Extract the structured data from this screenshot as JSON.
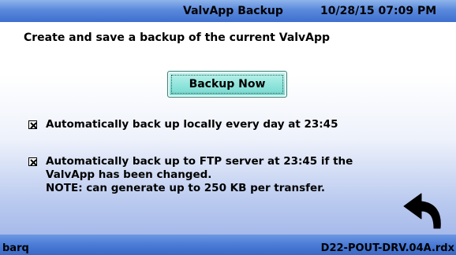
{
  "titlebar": {
    "title": "ValvApp Backup",
    "datetime": "10/28/15 07:09 PM"
  },
  "main": {
    "heading": "Create and save a backup of the current ValvApp",
    "backup_button_label": "Backup Now",
    "options": [
      {
        "checked": true,
        "lines": [
          "Automatically back up locally every day at 23:45"
        ]
      },
      {
        "checked": true,
        "lines": [
          "Automatically back up to FTP server at 23:45 if the",
          "ValvApp has been changed.",
          "NOTE: can generate up to 250 KB per transfer."
        ]
      }
    ],
    "back_icon": "back-arrow-icon"
  },
  "statusbar": {
    "user": "barq",
    "file": "D22-POUT-DRV.04A.rdx"
  },
  "colors": {
    "titlebar": "#5a89dc",
    "button": "#8fe4db",
    "statusbar": "#4a7bd6"
  }
}
